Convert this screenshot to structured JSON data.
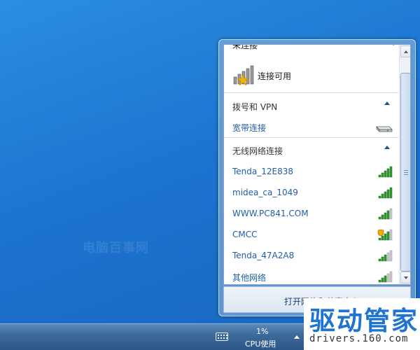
{
  "desktop": {
    "watermark": "电脑百事网"
  },
  "flyout": {
    "top_row": {
      "label": "未连接",
      "chevron": "›"
    },
    "status": {
      "label": "连接可用",
      "icon": "signal-warning-icon"
    },
    "dialup": {
      "header": "拨号和 VPN",
      "items": [
        {
          "label": "宽带连接",
          "icon": "modem-icon"
        }
      ]
    },
    "wireless": {
      "header": "无线网络连接",
      "items": [
        {
          "label": "Tenda_12E838",
          "icon": "wifi-signal-icon",
          "bars": 5,
          "secured": false
        },
        {
          "label": "midea_ca_1049",
          "icon": "wifi-signal-icon",
          "bars": 5,
          "secured": false
        },
        {
          "label": "WWW.PC841.COM",
          "icon": "wifi-signal-icon",
          "bars": 4,
          "secured": false
        },
        {
          "label": "CMCC",
          "icon": "wifi-shield-icon",
          "bars": 4,
          "secured": true
        },
        {
          "label": "Tenda_47A2A8",
          "icon": "wifi-signal-icon",
          "bars": 3,
          "secured": false
        },
        {
          "label": "其他网络",
          "icon": "wifi-signal-icon",
          "bars": 3,
          "secured": false
        }
      ]
    },
    "footer": {
      "link": "打开网络和共享中心"
    }
  },
  "taskbar": {
    "cpu_value": "1%",
    "cpu_label": "CPU使用"
  },
  "brand": {
    "name": "驱动管家",
    "url": "drivers.160.com"
  },
  "colors": {
    "link": "#1f5fa8",
    "signal_green": "#2e9a2e",
    "brand_blue": "#1f74d0"
  }
}
